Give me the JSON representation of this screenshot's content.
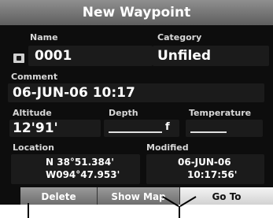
{
  "title": "New Waypoint",
  "name": {
    "label": "Name",
    "value": "0001"
  },
  "category": {
    "label": "Category",
    "value": "Unfiled"
  },
  "comment": {
    "label": "Comment",
    "value": "06-JUN-06 10:17"
  },
  "altitude": {
    "label": "Altitude",
    "value": "12'91'"
  },
  "depth": {
    "label": "Depth",
    "value": "f"
  },
  "temperature": {
    "label": "Temperature",
    "value": ""
  },
  "location": {
    "label": "Location",
    "lat": "N  38°51.384'",
    "lon": "W094°47.953'"
  },
  "modified": {
    "label": "Modified",
    "date": "06-JUN-06",
    "time": "10:17:56'"
  },
  "buttons": {
    "delete": "Delete",
    "show_map": "Show Map",
    "go_to": "Go To"
  }
}
